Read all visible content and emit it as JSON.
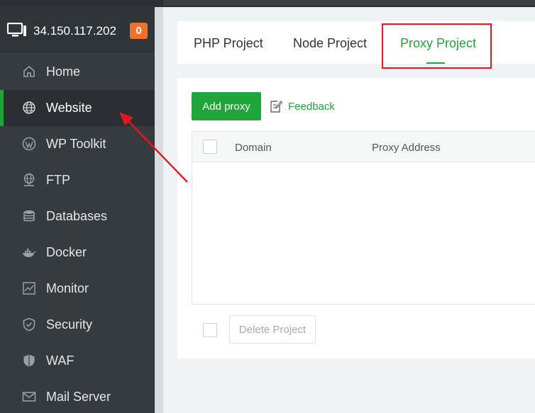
{
  "server": {
    "ip": "34.150.117.202",
    "badge": "0"
  },
  "sidebar": {
    "items": [
      {
        "label": "Home",
        "icon": "home-icon"
      },
      {
        "label": "Website",
        "icon": "globe-icon",
        "active": true
      },
      {
        "label": "WP Toolkit",
        "icon": "wordpress-icon"
      },
      {
        "label": "FTP",
        "icon": "ftp-globe-icon"
      },
      {
        "label": "Databases",
        "icon": "database-icon"
      },
      {
        "label": "Docker",
        "icon": "docker-icon"
      },
      {
        "label": "Monitor",
        "icon": "monitor-chart-icon"
      },
      {
        "label": "Security",
        "icon": "shield-icon"
      },
      {
        "label": "WAF",
        "icon": "waf-shield-icon"
      },
      {
        "label": "Mail Server",
        "icon": "mail-icon"
      }
    ]
  },
  "tabs": [
    {
      "label": "PHP Project"
    },
    {
      "label": "Node Project"
    },
    {
      "label": "Proxy Project",
      "active": true
    }
  ],
  "toolbar": {
    "add_label": "Add proxy",
    "feedback_label": "Feedback"
  },
  "table": {
    "columns": [
      "Domain",
      "Proxy Address"
    ],
    "rows": []
  },
  "footer": {
    "delete_label": "Delete Project"
  },
  "colors": {
    "accent": "#20a53a",
    "sidebar": "#363b40",
    "badge": "#f0712b",
    "annotation": "#e0191f"
  }
}
